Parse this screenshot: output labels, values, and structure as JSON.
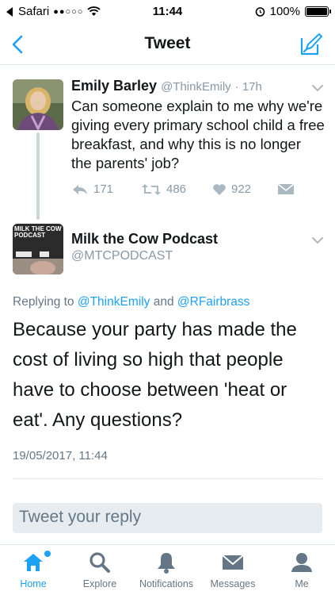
{
  "status_bar": {
    "carrier": "Safari",
    "signal": "●●○○○",
    "time": "11:44",
    "battery": "100%"
  },
  "nav": {
    "title": "Tweet"
  },
  "parent_tweet": {
    "name": "Emily Barley",
    "handle": "@ThinkEmily",
    "age": "· 17h",
    "text": "Can someone explain to me why we're giving every primary school child a free breakfast, and why this is no longer the parents' job?",
    "replies": "171",
    "retweets": "486",
    "likes": "922"
  },
  "main_tweet": {
    "name": "Milk the Cow Podcast",
    "handle": "@MTCPODCAST",
    "avatar_text": "MILK THE COW PODCAST",
    "replying_prefix": "Replying to",
    "reply_user_1": "@ThinkEmily",
    "reply_and": "and",
    "reply_user_2": "@RFairbrass",
    "text": "Because your party has made the cost of living so high that people have to choose between 'heat or eat'. Any questions?",
    "timestamp": "19/05/2017, 11:44"
  },
  "reply_box": {
    "placeholder": "Tweet your reply"
  },
  "tabs": [
    {
      "label": "Home",
      "icon": "home-icon"
    },
    {
      "label": "Explore",
      "icon": "search-icon"
    },
    {
      "label": "Notifications",
      "icon": "bell-icon"
    },
    {
      "label": "Messages",
      "icon": "envelope-icon"
    },
    {
      "label": "Me",
      "icon": "person-icon"
    }
  ],
  "colors": {
    "accent": "#1da1f2",
    "muted": "#8899a6",
    "text": "#14171a"
  }
}
